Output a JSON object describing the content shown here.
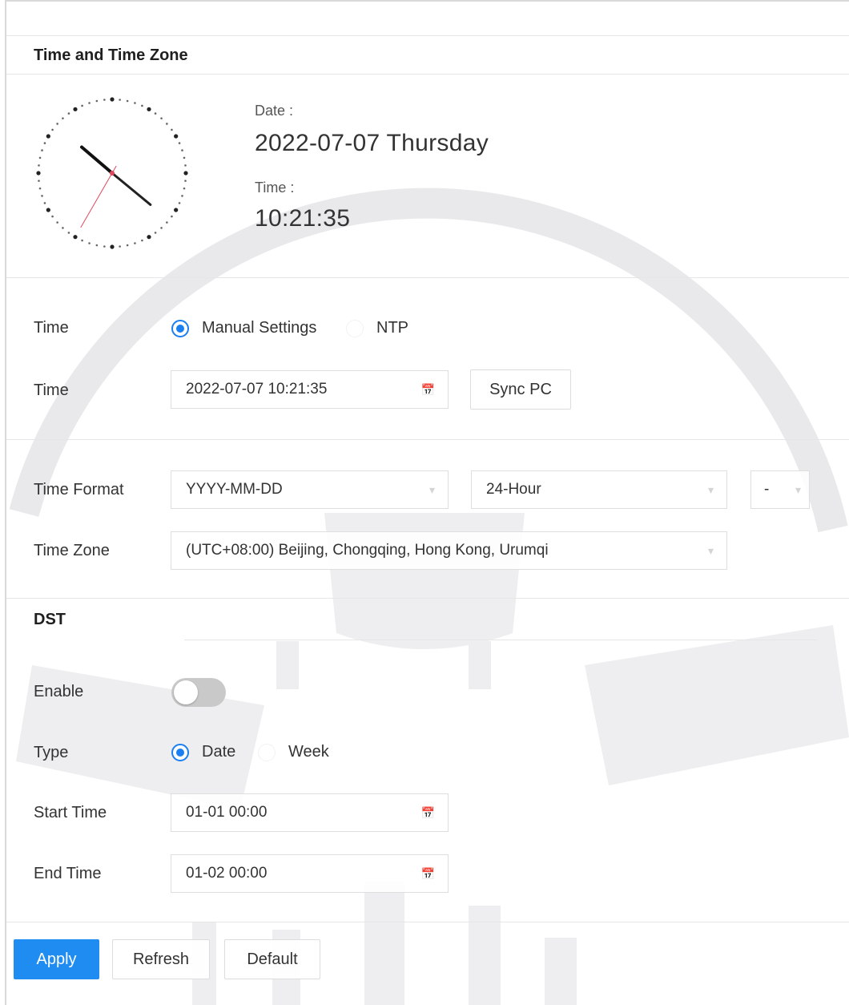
{
  "header": {
    "title": "Time and Time Zone"
  },
  "current": {
    "date_label": "Date :",
    "date_value": "2022-07-07 Thursday",
    "time_label": "Time :",
    "time_value": "10:21:35"
  },
  "clock": {
    "hour": 10,
    "minute": 21,
    "second": 35
  },
  "time_mode": {
    "label": "Time",
    "options": [
      {
        "label": "Manual Settings",
        "selected": true
      },
      {
        "label": "NTP",
        "selected": false
      }
    ]
  },
  "time_field": {
    "label": "Time",
    "value": "2022-07-07 10:21:35",
    "sync_button": "Sync PC"
  },
  "time_format": {
    "label": "Time Format",
    "date_format": "YYYY-MM-DD",
    "hour_format": "24-Hour",
    "separator": "-"
  },
  "time_zone": {
    "label": "Time Zone",
    "value": "(UTC+08:00) Beijing, Chongqing, Hong Kong, Urumqi"
  },
  "dst": {
    "title": "DST",
    "enable_label": "Enable",
    "enabled": false,
    "type_label": "Type",
    "type_options": [
      {
        "label": "Date",
        "selected": true
      },
      {
        "label": "Week",
        "selected": false
      }
    ],
    "start_label": "Start Time",
    "start_value": "01-01 00:00",
    "end_label": "End Time",
    "end_value": "01-02 00:00"
  },
  "footer": {
    "apply": "Apply",
    "refresh": "Refresh",
    "default": "Default"
  },
  "colors": {
    "accent": "#1f8cf2",
    "radio": "#1a7ff0",
    "toggle_off": "#c9c9c9"
  }
}
